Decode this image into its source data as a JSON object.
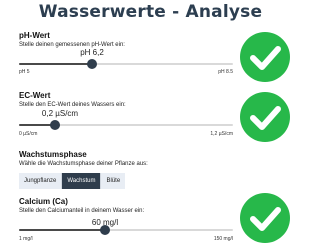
{
  "page_title": "Wasserwerte - Analyse",
  "colors": {
    "accent": "#2f3d4c",
    "success": "#27b84a"
  },
  "ph": {
    "label": "pH-Wert",
    "description": "Stelle deinen gemessenen pH-Wert ein:",
    "value_text": "pH 6,2",
    "min_text": "pH 5",
    "max_text": "pH 8.5",
    "level": 0.34,
    "status_icon": "checkmark-icon"
  },
  "ec": {
    "label": "EC-Wert",
    "description": "Stelle den EC-Wert deines Wassers ein:",
    "value_text": "0,2 µS/cm",
    "min_text": "0 µS/cm",
    "max_text": "1,2 µS/cm",
    "level": 0.17,
    "status_icon": "checkmark-icon"
  },
  "growth": {
    "label": "Wachstumsphase",
    "description": "Wähle die Wachstumsphase deiner Pflanze aus:",
    "options": [
      "Jungpflanze",
      "Wachstum",
      "Blüte"
    ],
    "selected": "Wachstum"
  },
  "calcium": {
    "label": "Calcium (Ca)",
    "description": "Stelle den Calciumanteil in deinem Wasser ein:",
    "value_text": "60 mg/l",
    "min_text": "1 mg/l",
    "max_text": "150 mg/l",
    "level": 0.4,
    "status_icon": "checkmark-icon"
  }
}
